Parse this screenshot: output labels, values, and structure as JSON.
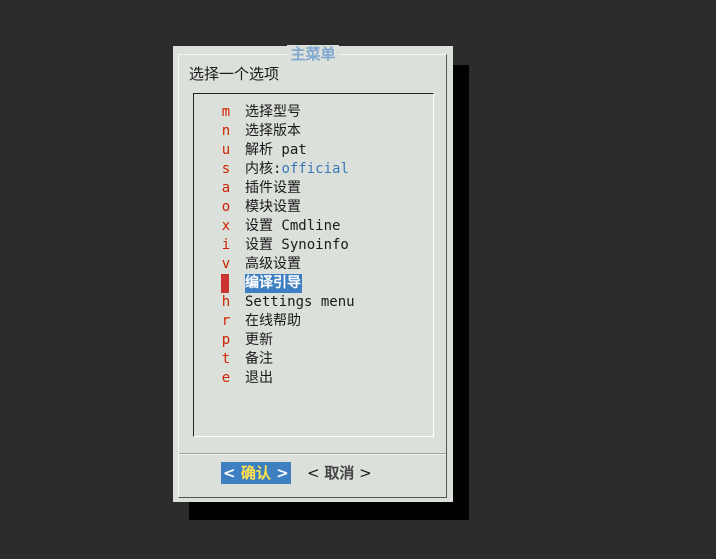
{
  "dialog": {
    "title": "主菜单",
    "prompt": "选择一个选项"
  },
  "menu": {
    "items": [
      {
        "key": "m",
        "label": "选择型号",
        "value": ""
      },
      {
        "key": "n",
        "label": "选择版本",
        "value": ""
      },
      {
        "key": "u",
        "label": "解析 pat",
        "value": ""
      },
      {
        "key": "s",
        "label": "内核: ",
        "value": "official"
      },
      {
        "key": "a",
        "label": "插件设置",
        "value": ""
      },
      {
        "key": "o",
        "label": "模块设置",
        "value": ""
      },
      {
        "key": "x",
        "label": "设置 Cmdline",
        "value": ""
      },
      {
        "key": "i",
        "label": "设置 Synoinfo",
        "value": ""
      },
      {
        "key": "v",
        "label": "高级设置",
        "value": ""
      },
      {
        "key": "d",
        "label": "编译引导",
        "value": ""
      },
      {
        "key": "h",
        "label": "Settings menu",
        "value": ""
      },
      {
        "key": "r",
        "label": "在线帮助",
        "value": ""
      },
      {
        "key": "p",
        "label": "更新",
        "value": ""
      },
      {
        "key": "t",
        "label": "备注",
        "value": ""
      },
      {
        "key": "e",
        "label": "退出",
        "value": ""
      }
    ],
    "selected_index": 9
  },
  "buttons": {
    "ok": {
      "left": "<",
      "label": "确认",
      "right": ">"
    },
    "cancel": {
      "left": "<",
      "label": "取消",
      "right": ">"
    }
  },
  "colors": {
    "background": "#2c2c2c",
    "dialog": "#dce0db",
    "hotkey": "#cc2200",
    "selection": "#3d7fc0",
    "ok_text": "#ffe14d",
    "title": "#7fa8d0"
  }
}
